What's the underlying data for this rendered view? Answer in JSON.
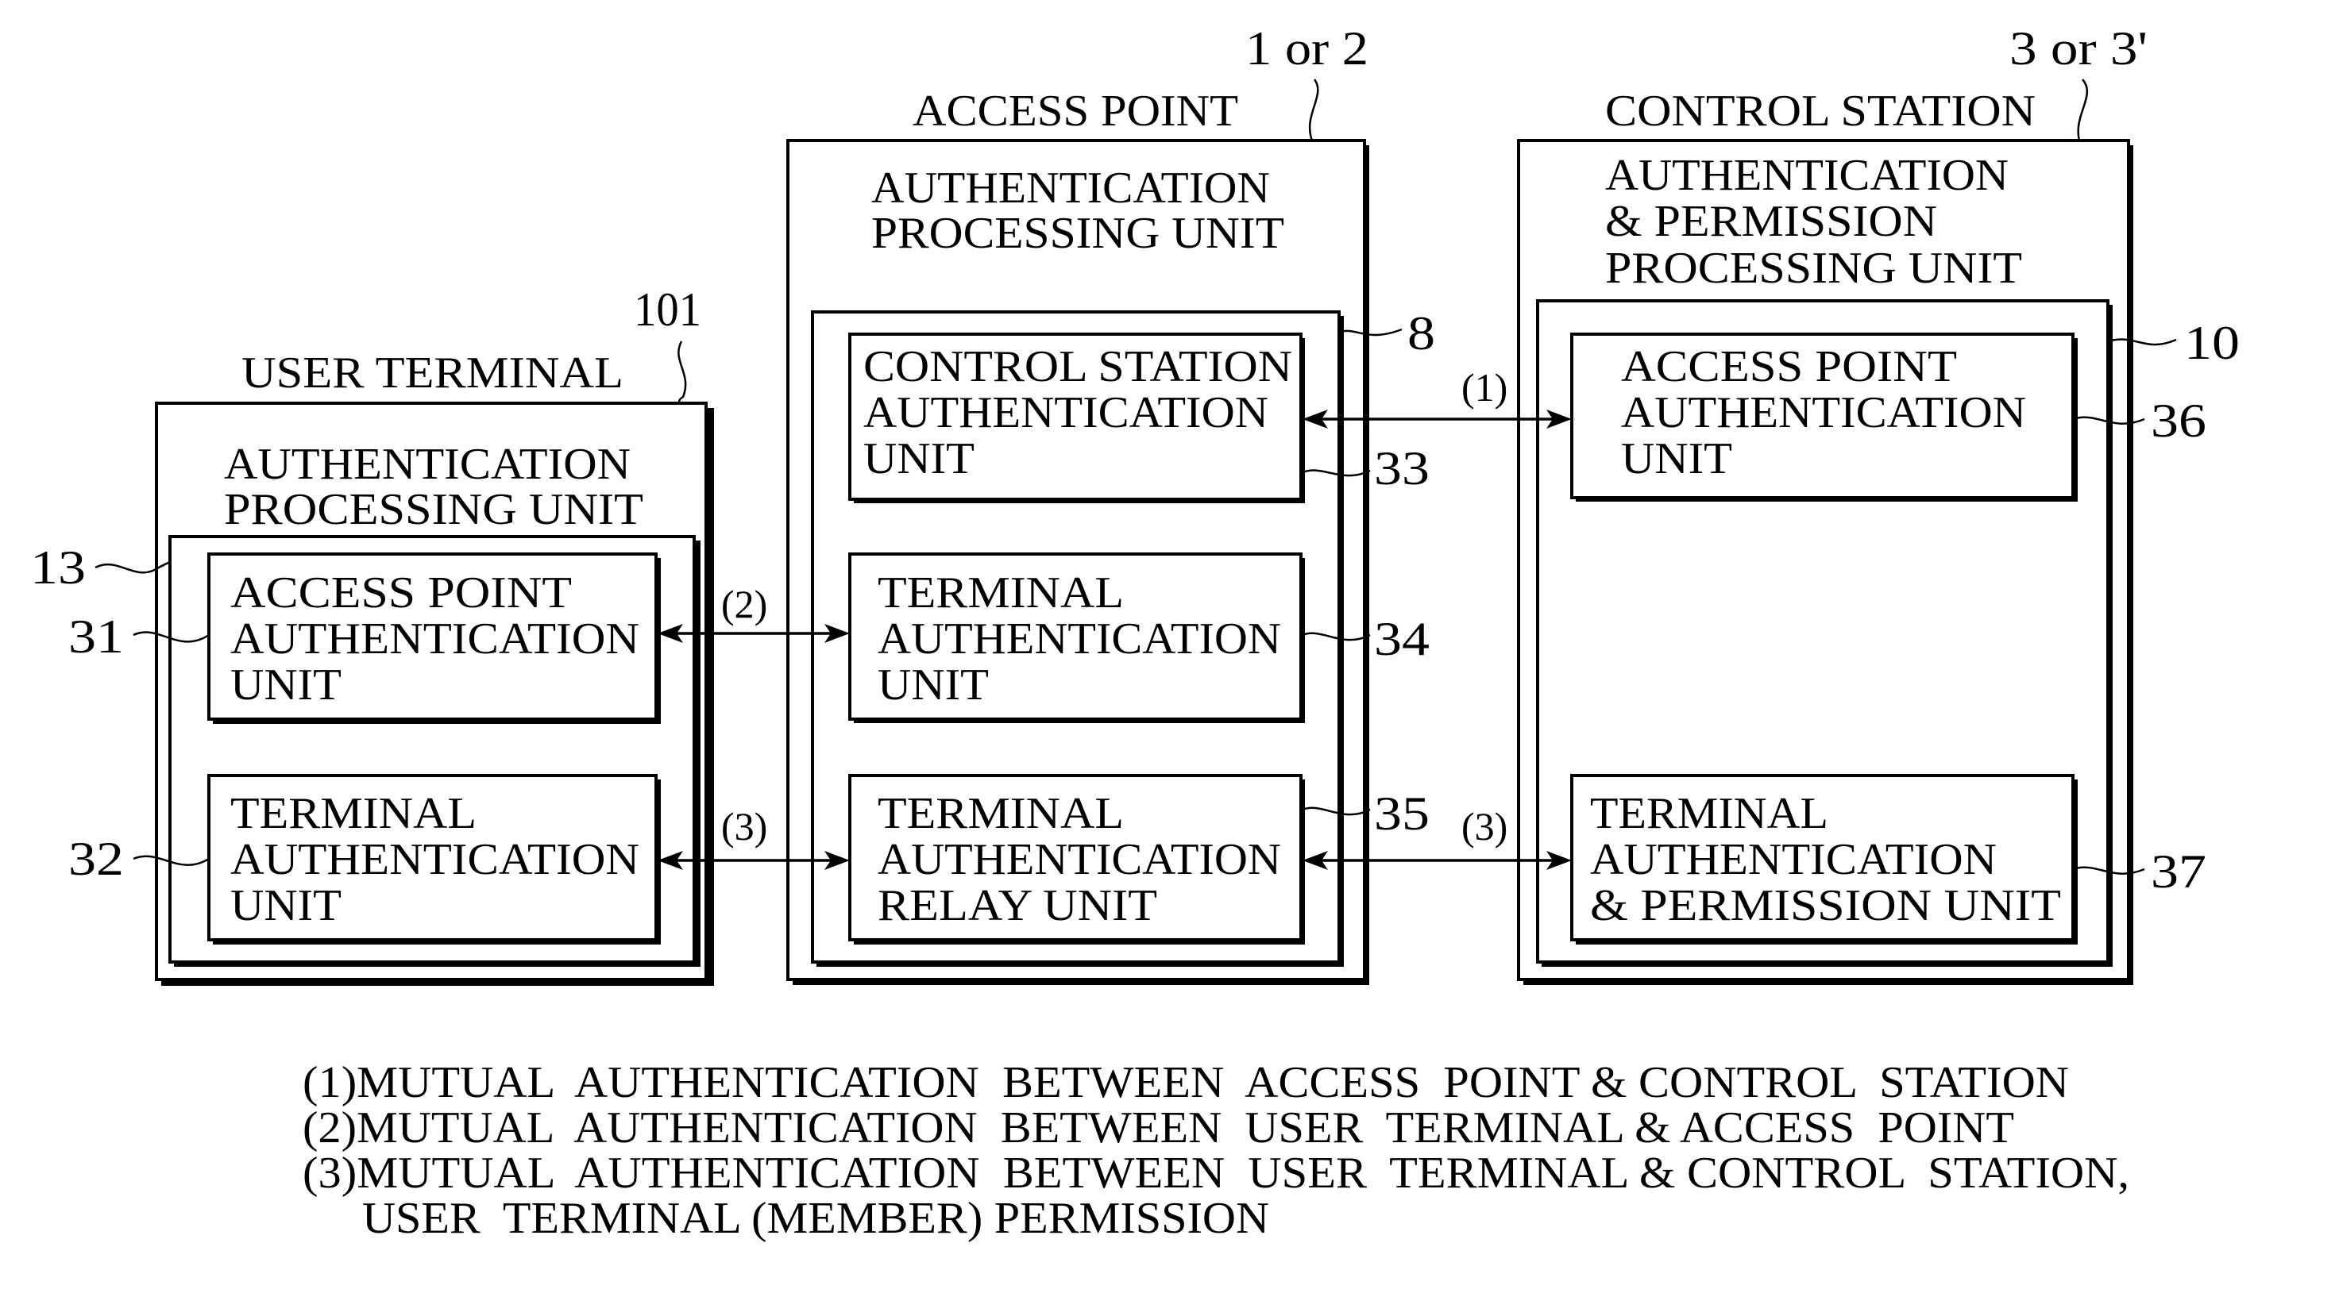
{
  "figure": {
    "devices": [
      {
        "id": "user_terminal",
        "title": "USER TERMINAL",
        "ref": "101",
        "processing_unit": {
          "lines": [
            "AUTHENTICATION",
            "PROCESSING UNIT"
          ],
          "ref": "13"
        },
        "units": [
          {
            "ref": "31",
            "lines": [
              "ACCESS POINT",
              "AUTHENTICATION",
              "UNIT"
            ]
          },
          {
            "ref": "32",
            "lines": [
              "TERMINAL",
              "AUTHENTICATION",
              "UNIT"
            ]
          }
        ]
      },
      {
        "id": "access_point",
        "title": "ACCESS POINT",
        "ref": "1 or 2",
        "processing_unit": {
          "lines": [
            "AUTHENTICATION",
            "PROCESSING UNIT"
          ],
          "ref": "8"
        },
        "units": [
          {
            "ref": "33",
            "lines": [
              "CONTROL STATION",
              "AUTHENTICATION",
              "UNIT"
            ]
          },
          {
            "ref": "34",
            "lines": [
              "TERMINAL",
              "AUTHENTICATION",
              "UNIT"
            ]
          },
          {
            "ref": "35",
            "lines": [
              "TERMINAL",
              "AUTHENTICATION",
              "RELAY UNIT"
            ]
          }
        ]
      },
      {
        "id": "control_station",
        "title": "CONTROL STATION",
        "ref": "3 or 3'",
        "processing_unit": {
          "lines": [
            "AUTHENTICATION",
            "& PERMISSION",
            "PROCESSING UNIT"
          ],
          "ref": "10"
        },
        "units": [
          {
            "ref": "36",
            "lines": [
              "ACCESS POINT",
              "AUTHENTICATION",
              "UNIT"
            ]
          },
          {
            "ref": "37",
            "lines": [
              "TERMINAL",
              "AUTHENTICATION",
              "& PERMISSION UNIT"
            ]
          }
        ]
      }
    ],
    "connections": [
      {
        "label": "(1)",
        "from": "33",
        "to": "36",
        "bidirectional": true
      },
      {
        "label": "(2)",
        "from": "31",
        "to": "34",
        "bidirectional": true
      },
      {
        "label": "(3)",
        "from": "32",
        "to": "35",
        "bidirectional": true
      },
      {
        "label": "(3)",
        "from": "35",
        "to": "37",
        "bidirectional": true
      }
    ],
    "legend": [
      "(1)MUTUAL  AUTHENTICATION  BETWEEN  ACCESS  POINT & CONTROL  STATION",
      "(2)MUTUAL  AUTHENTICATION  BETWEEN  USER  TERMINAL & ACCESS  POINT",
      "(3)MUTUAL  AUTHENTICATION  BETWEEN  USER  TERMINAL & CONTROL  STATION,",
      "USER  TERMINAL (MEMBER) PERMISSION"
    ]
  }
}
